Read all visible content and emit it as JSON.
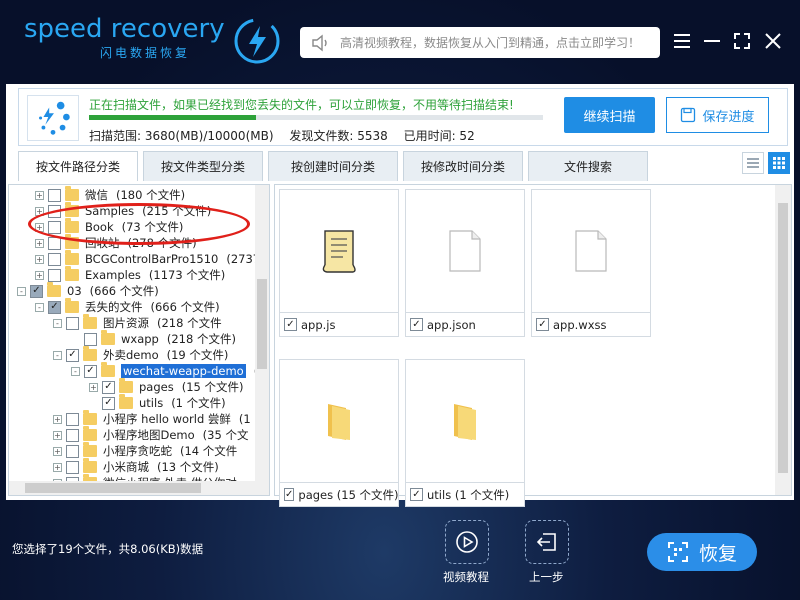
{
  "app": {
    "logo_text": "speed recovery",
    "logo_sub": "闪电数据恢复",
    "search_placeholder": "高清视频教程，数据恢复从入门到精通，点击立即学习！"
  },
  "scan": {
    "message": "正在扫描文件，如果已经找到您丢失的文件，可以立即恢复，不用等待扫描结束!",
    "progress_fraction": 0.368,
    "range": "扫描范围: 3680(MB)/10000(MB)",
    "found": "发现文件数: 5538",
    "elapsed": "已用时间: 52",
    "continue_label": "继续扫描",
    "save_label": "保存进度"
  },
  "tabs": [
    {
      "label": "按文件路径分类",
      "active": true
    },
    {
      "label": "按文件类型分类",
      "active": false
    },
    {
      "label": "按创建时间分类",
      "active": false
    },
    {
      "label": "按修改时间分类",
      "active": false
    },
    {
      "label": "文件搜索",
      "active": false
    }
  ],
  "tree": [
    {
      "label": "微信",
      "count": "(180 个文件)",
      "depth": 1,
      "exp": "+",
      "cb": "none"
    },
    {
      "label": "Samples",
      "count": "(215 个文件)",
      "depth": 1,
      "exp": "+",
      "cb": "none"
    },
    {
      "label": "Book",
      "count": "(73 个文件)",
      "depth": 1,
      "exp": "+",
      "cb": "none"
    },
    {
      "label": "回收站",
      "count": "(278 个文件)",
      "depth": 1,
      "exp": "+",
      "cb": "none"
    },
    {
      "label": "BCGControlBarPro1510",
      "count": "(2737 个",
      "depth": 1,
      "exp": "+",
      "cb": "none"
    },
    {
      "label": "Examples",
      "count": "(1173 个文件)",
      "depth": 1,
      "exp": "+",
      "cb": "none"
    },
    {
      "label": "03",
      "count": "(666 个文件)",
      "depth": 0,
      "exp": "-",
      "cb": "partial"
    },
    {
      "label": "丢失的文件",
      "count": "(666 个文件)",
      "depth": 1,
      "exp": "-",
      "cb": "partial"
    },
    {
      "label": "图片资源",
      "count": "(218 个文件",
      "depth": 2,
      "exp": "-",
      "cb": "none"
    },
    {
      "label": "wxapp",
      "count": "(218 个文件)",
      "depth": 3,
      "exp": "",
      "cb": "none"
    },
    {
      "label": "外卖demo",
      "count": "(19 个文件)",
      "depth": 2,
      "exp": "-",
      "cb": "checked"
    },
    {
      "label": "wechat-weapp-demo",
      "count": "(1",
      "depth": 3,
      "exp": "-",
      "cb": "checked",
      "selected": true
    },
    {
      "label": "pages",
      "count": "(15 个文件)",
      "depth": 4,
      "exp": "+",
      "cb": "checked"
    },
    {
      "label": "utils",
      "count": "(1 个文件)",
      "depth": 4,
      "exp": "",
      "cb": "checked"
    },
    {
      "label": "小程序 hello world 尝鲜",
      "count": "(1",
      "depth": 2,
      "exp": "+",
      "cb": "none"
    },
    {
      "label": "小程序地图Demo",
      "count": "(35 个文",
      "depth": 2,
      "exp": "+",
      "cb": "none"
    },
    {
      "label": "小程序贪吃蛇",
      "count": "(14 个文件",
      "depth": 2,
      "exp": "+",
      "cb": "none"
    },
    {
      "label": "小米商城",
      "count": "(13 个文件)",
      "depth": 2,
      "exp": "+",
      "cb": "none"
    },
    {
      "label": "微信小程序 外卖 供公你对",
      "count": "",
      "depth": 2,
      "exp": "+",
      "cb": "none"
    }
  ],
  "files": [
    {
      "name": "app.js",
      "kind": "script"
    },
    {
      "name": "app.json",
      "kind": "doc"
    },
    {
      "name": "app.wxss",
      "kind": "doc"
    },
    {
      "name": "pages  (15 个文件)",
      "kind": "folder"
    },
    {
      "name": "utils  (1 个文件)",
      "kind": "folder"
    }
  ],
  "bottom": {
    "status": "您选择了19个文件，共8.06(KB)数据",
    "video_label": "视频教程",
    "back_label": "上一步",
    "recover_label": "恢复"
  },
  "colors": {
    "accent": "#1f8de4",
    "progress": "#2ea23a",
    "highlight": "#1f6fd6",
    "annotation": "#e0201a"
  }
}
